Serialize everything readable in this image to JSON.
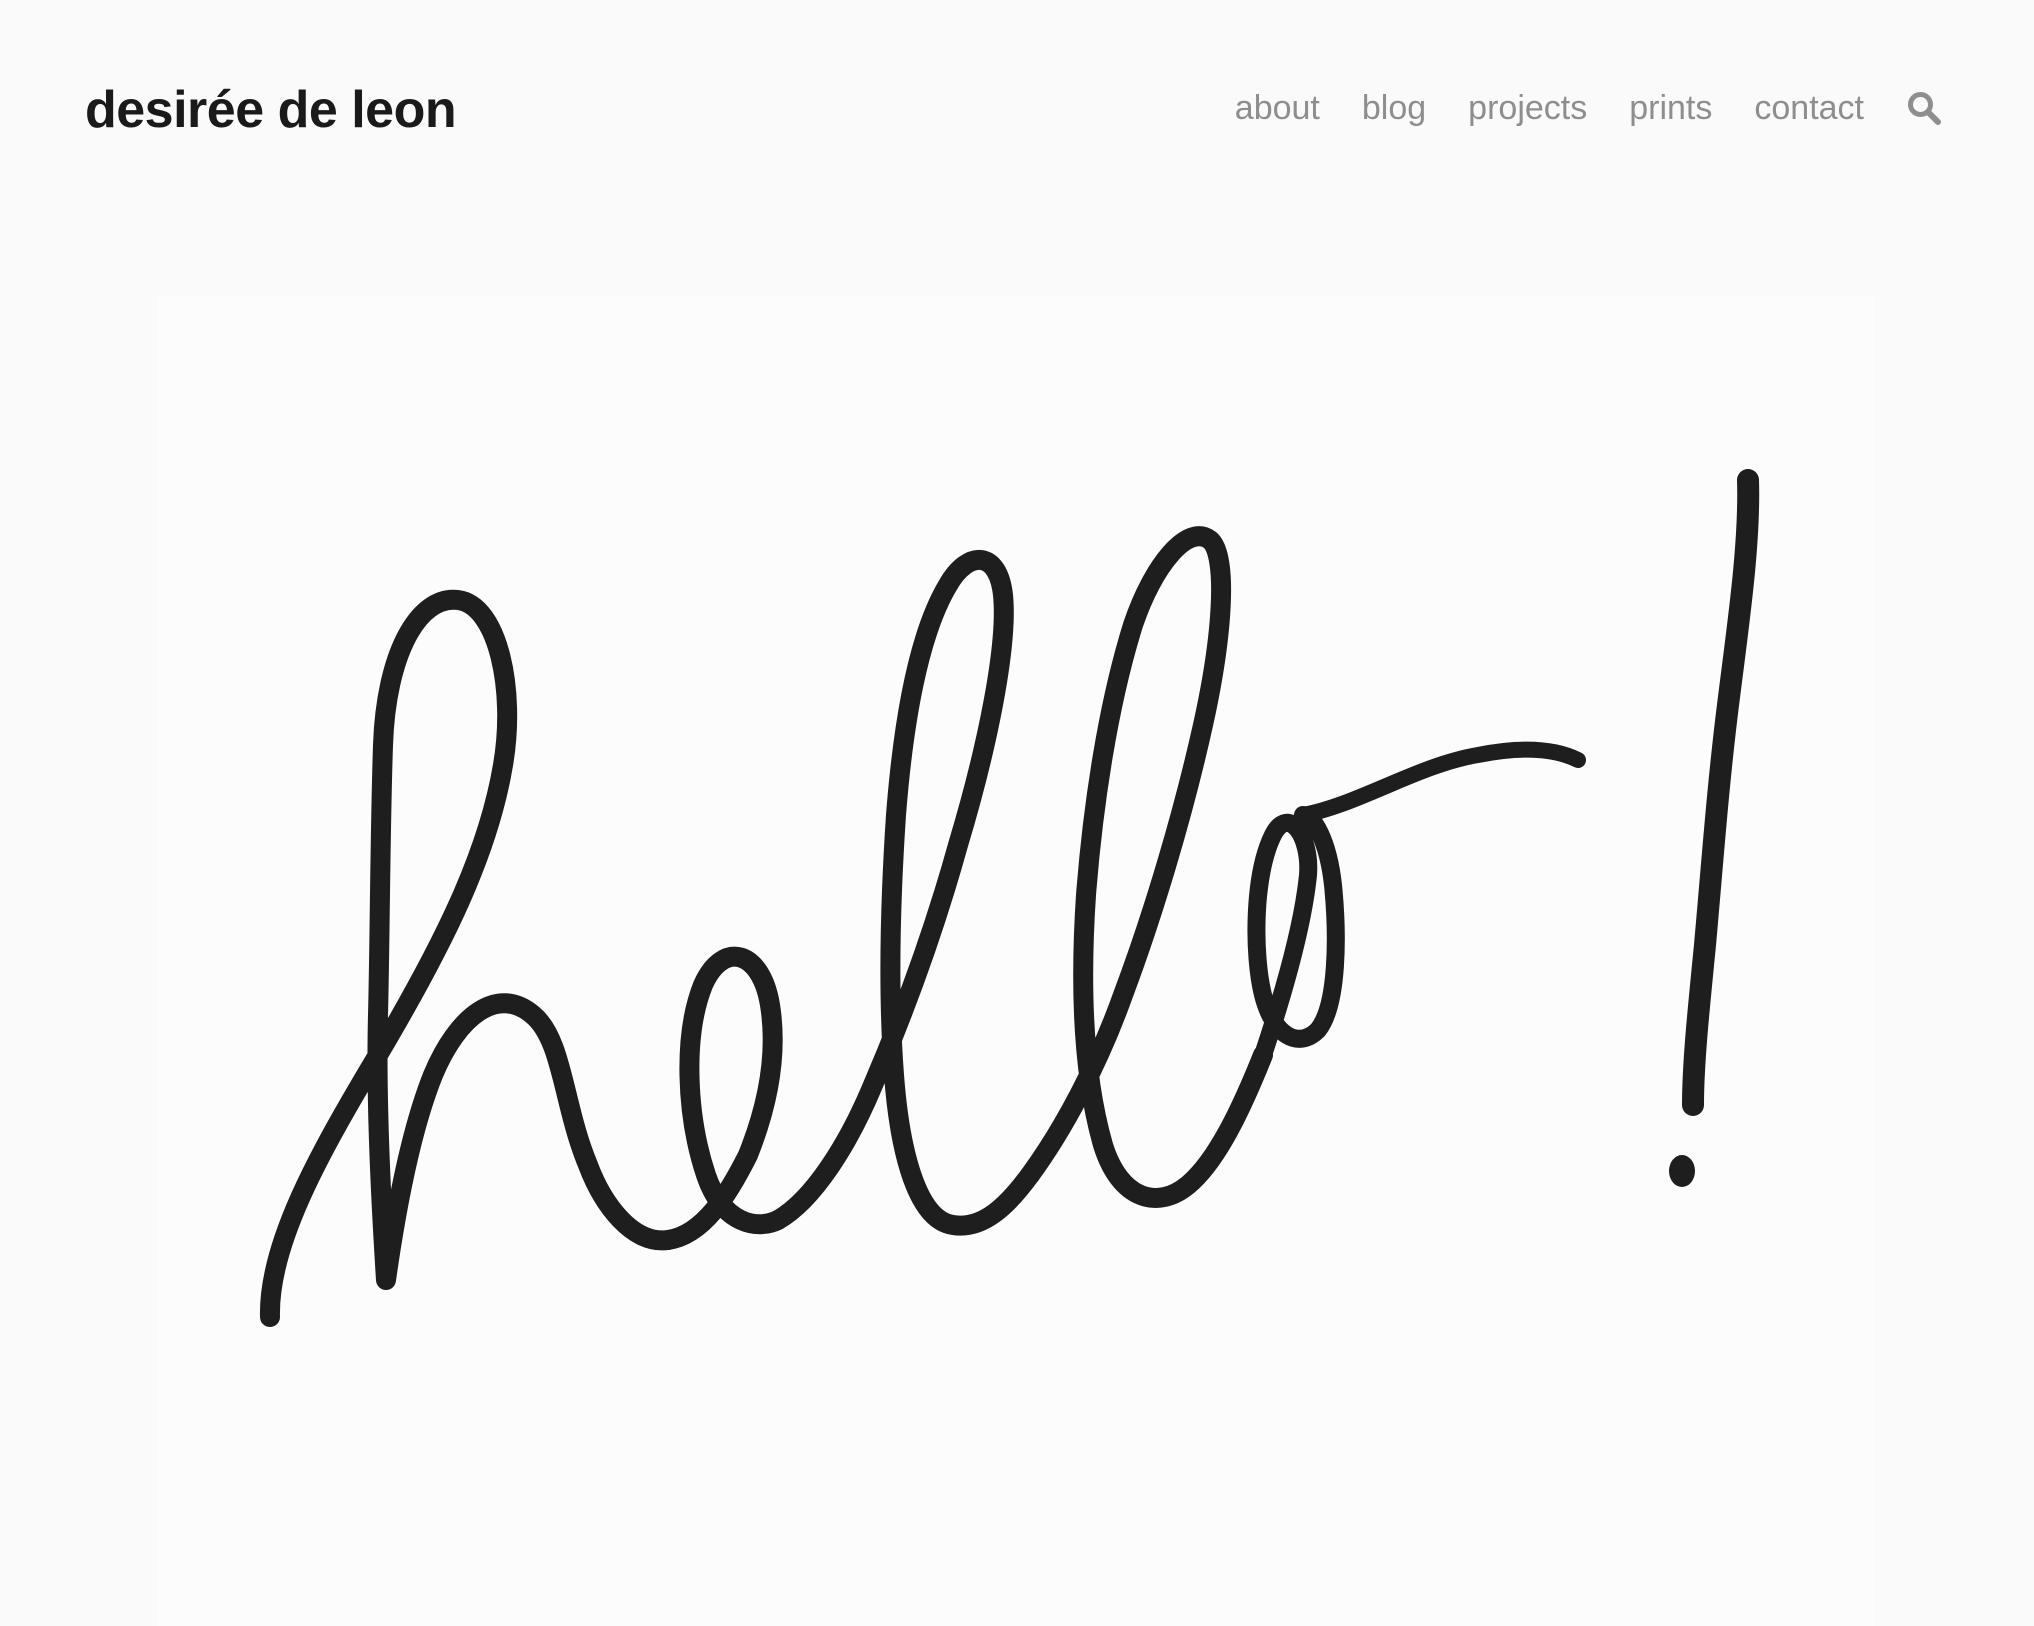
{
  "site": {
    "title": "desirée de leon"
  },
  "nav": {
    "items": [
      {
        "label": "about"
      },
      {
        "label": "blog"
      },
      {
        "label": "projects"
      },
      {
        "label": "prints"
      },
      {
        "label": "contact"
      }
    ],
    "search_icon": "search-icon"
  },
  "hero": {
    "lettering": "hello!"
  },
  "colors": {
    "background": "#fafafa",
    "title": "#1a1a1a",
    "nav": "#8e8e8e",
    "ink": "#1e1e1e"
  }
}
